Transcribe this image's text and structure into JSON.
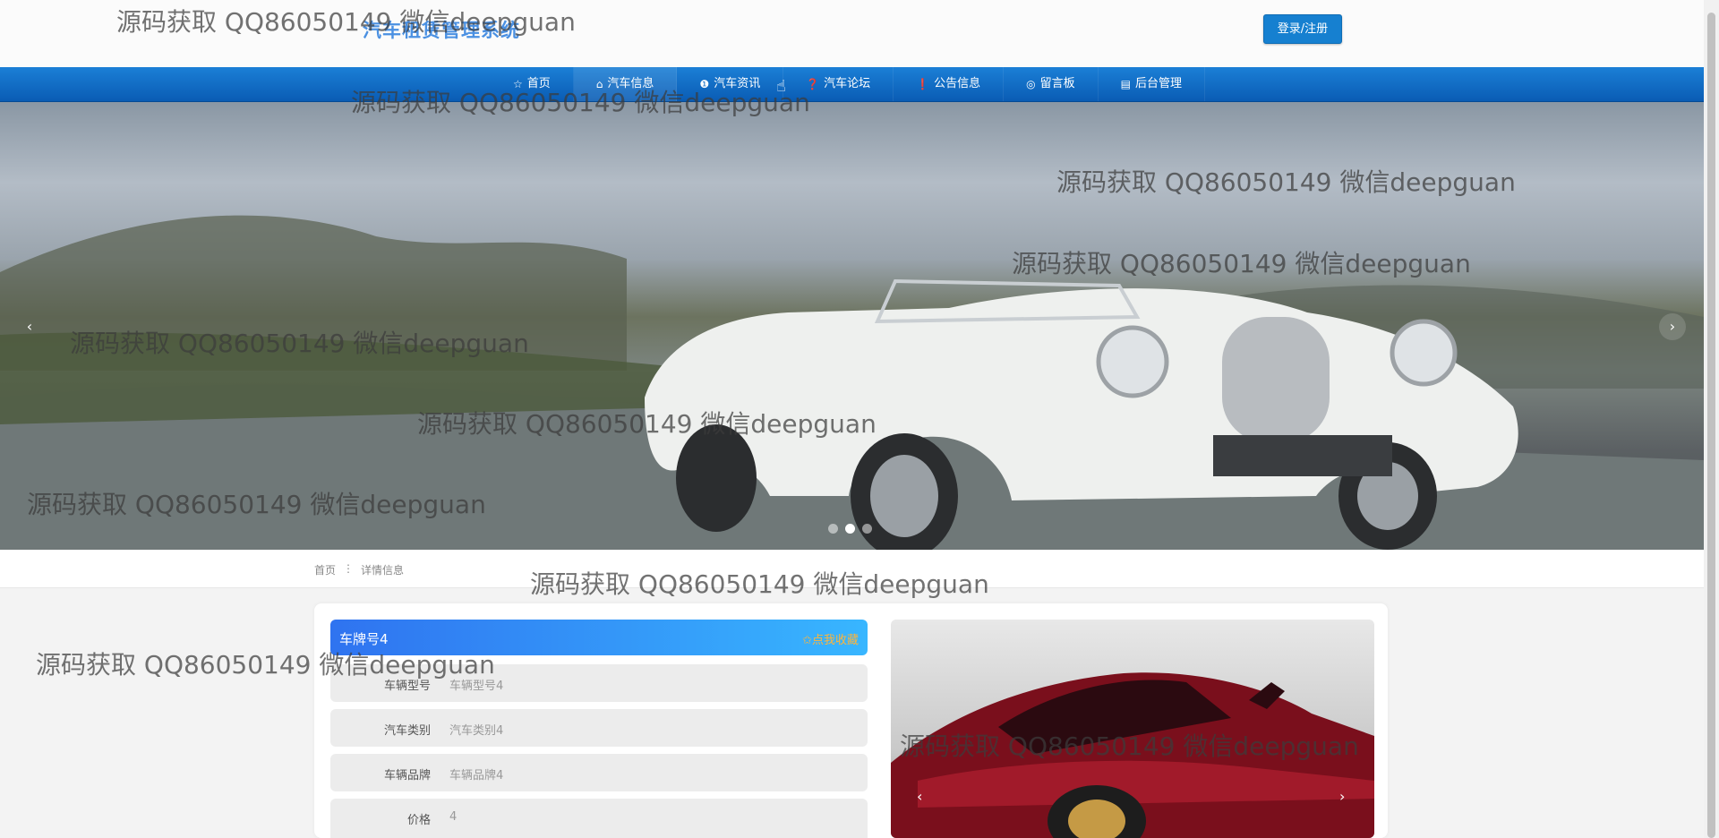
{
  "header": {
    "site_title": "汽车租赁管理系统",
    "login_label": "登录/注册"
  },
  "nav": {
    "items": [
      {
        "icon": "☆",
        "label": "首页"
      },
      {
        "icon": "⌂",
        "label": "汽车信息"
      },
      {
        "icon": "❶",
        "label": "汽车资讯"
      },
      {
        "icon": "❓",
        "label": "汽车论坛"
      },
      {
        "icon": "❗",
        "label": "公告信息"
      },
      {
        "icon": "◎",
        "label": "留言板"
      },
      {
        "icon": "▤",
        "label": "后台管理"
      }
    ]
  },
  "banner": {
    "prev": "‹",
    "next": "›",
    "active_slide": 2,
    "slide_count": 3
  },
  "breadcrumb": {
    "home": "首页",
    "sep": "⋮",
    "current": "详情信息"
  },
  "detail": {
    "title": "车牌号4",
    "favorite_label": "✩点我收藏",
    "fields": [
      {
        "label": "车辆型号",
        "value": "车辆型号4"
      },
      {
        "label": "汽车类别",
        "value": "汽车类别4"
      },
      {
        "label": "车辆品牌",
        "value": "车辆品牌4"
      },
      {
        "label": "价格",
        "value": "4"
      }
    ]
  },
  "gallery": {
    "prev": "‹",
    "next": "›"
  },
  "watermark": "源码获取 QQ86050149 微信deepguan",
  "colors": {
    "nav": "#0a5cb4",
    "accent": "#2f73f0",
    "favorite": "#ffb43a"
  }
}
